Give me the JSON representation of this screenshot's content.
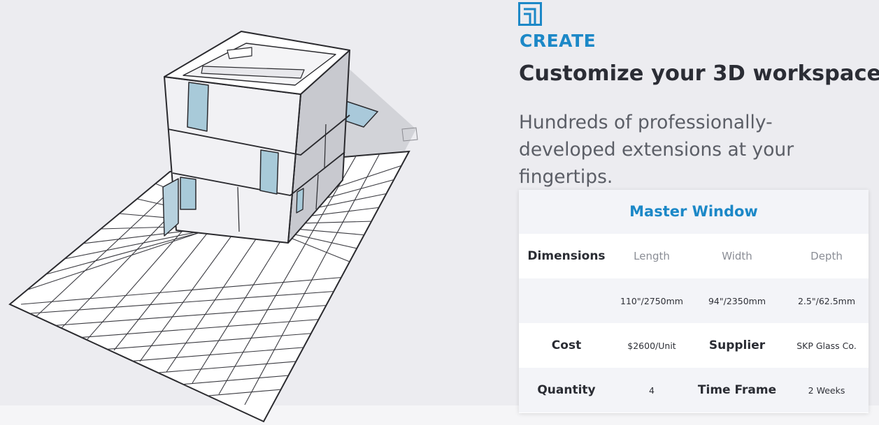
{
  "section": {
    "eyebrow": "CREATE",
    "headline": "Customize your 3D workspace",
    "subtext": "Hundreds of professionally-developed extensions at your fingertips.",
    "icon": "sketchup-create-icon",
    "accent_color": "#1c88c7"
  },
  "model_view": {
    "icon": "3d-house-model-illustration"
  },
  "spec_card": {
    "title": "Master Window",
    "dimensions": {
      "label": "Dimensions",
      "headers": [
        "Length",
        "Width",
        "Depth"
      ],
      "values": [
        "110\"/2750mm",
        "94\"/2350mm",
        "2.5\"/62.5mm"
      ]
    },
    "cost": {
      "label": "Cost",
      "value": "$2600/Unit"
    },
    "supplier": {
      "label": "Supplier",
      "value": "SKP Glass Co."
    },
    "quantity": {
      "label": "Quantity",
      "value": "4"
    },
    "time_frame": {
      "label": "Time Frame",
      "value": "2 Weeks"
    }
  }
}
